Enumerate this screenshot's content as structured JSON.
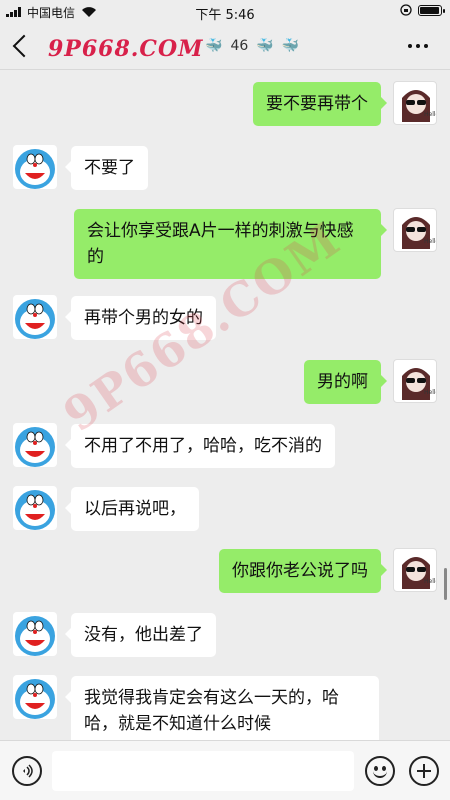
{
  "status": {
    "carrier": "中国电信",
    "time": "下午 5:46",
    "battery_level": 0.95
  },
  "nav": {
    "watermark": "9P668.COM",
    "title_suffix": "46"
  },
  "overlay_watermark": "9P668.COM",
  "messages": [
    {
      "side": "right",
      "text": "要不要再带个"
    },
    {
      "side": "left",
      "text": "不要了"
    },
    {
      "side": "right",
      "text": "会让你享受跟A片一样的刺激与快感的"
    },
    {
      "side": "left",
      "text": "再带个男的女的"
    },
    {
      "side": "right",
      "text": "男的啊"
    },
    {
      "side": "left",
      "text": "不用了不用了，哈哈，吃不消的"
    },
    {
      "side": "left",
      "text": "以后再说吧，"
    },
    {
      "side": "right",
      "text": "你跟你老公说了吗"
    },
    {
      "side": "left",
      "text": "没有，他出差了"
    },
    {
      "side": "left",
      "text": "我觉得我肯定会有这么一天的，哈哈，就是不知道什么时候"
    }
  ],
  "input": {
    "placeholder": ""
  },
  "colors": {
    "bubble_self": "#95ec69",
    "bubble_other": "#ffffff",
    "background": "#ededed"
  },
  "icons": [
    "back-icon",
    "more-icon",
    "voice-icon",
    "emoji-icon",
    "plus-icon",
    "doraemon-avatar",
    "sunglasses-girl-avatar"
  ]
}
